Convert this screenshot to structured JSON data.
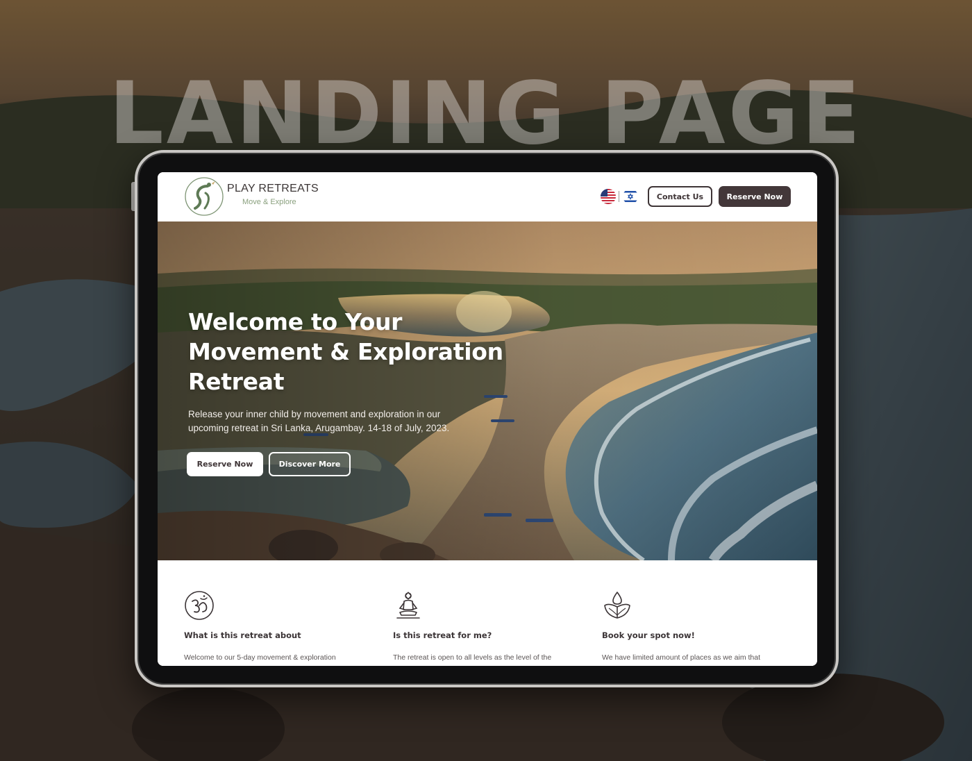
{
  "watermark": "LANDING PAGE",
  "site": {
    "brand_name": "PLAY RETREATS",
    "tagline": "Move & Explore",
    "languages": [
      "us-flag-icon",
      "israel-flag-icon"
    ],
    "contact_label": "Contact Us",
    "reserve_label": "Reserve Now"
  },
  "hero": {
    "title_lines": [
      "Welcome to Your",
      "Movement & Exploration",
      "Retreat"
    ],
    "subtitle_lines": [
      "Release your inner child by movement and exploration in our",
      "upcoming retreat in Sri Lanka, Arugambay. 14-18 of July, 2023."
    ],
    "primary_button": "Reserve Now",
    "secondary_button": "Discover More"
  },
  "features": [
    {
      "icon": "om-icon",
      "title": "What is this retreat about",
      "text": "Welcome to our 5-day movement & exploration"
    },
    {
      "icon": "meditation-icon",
      "title": "Is this retreat for me?",
      "text": "The retreat is open to all levels as the level of the"
    },
    {
      "icon": "lotus-drop-icon",
      "title": "Book your spot now!",
      "text": "We have limited amount of places as we aim that"
    }
  ],
  "colors": {
    "brand_dark": "#433739",
    "brand_green": "#6f8a63",
    "text_dark": "#3b3436"
  }
}
